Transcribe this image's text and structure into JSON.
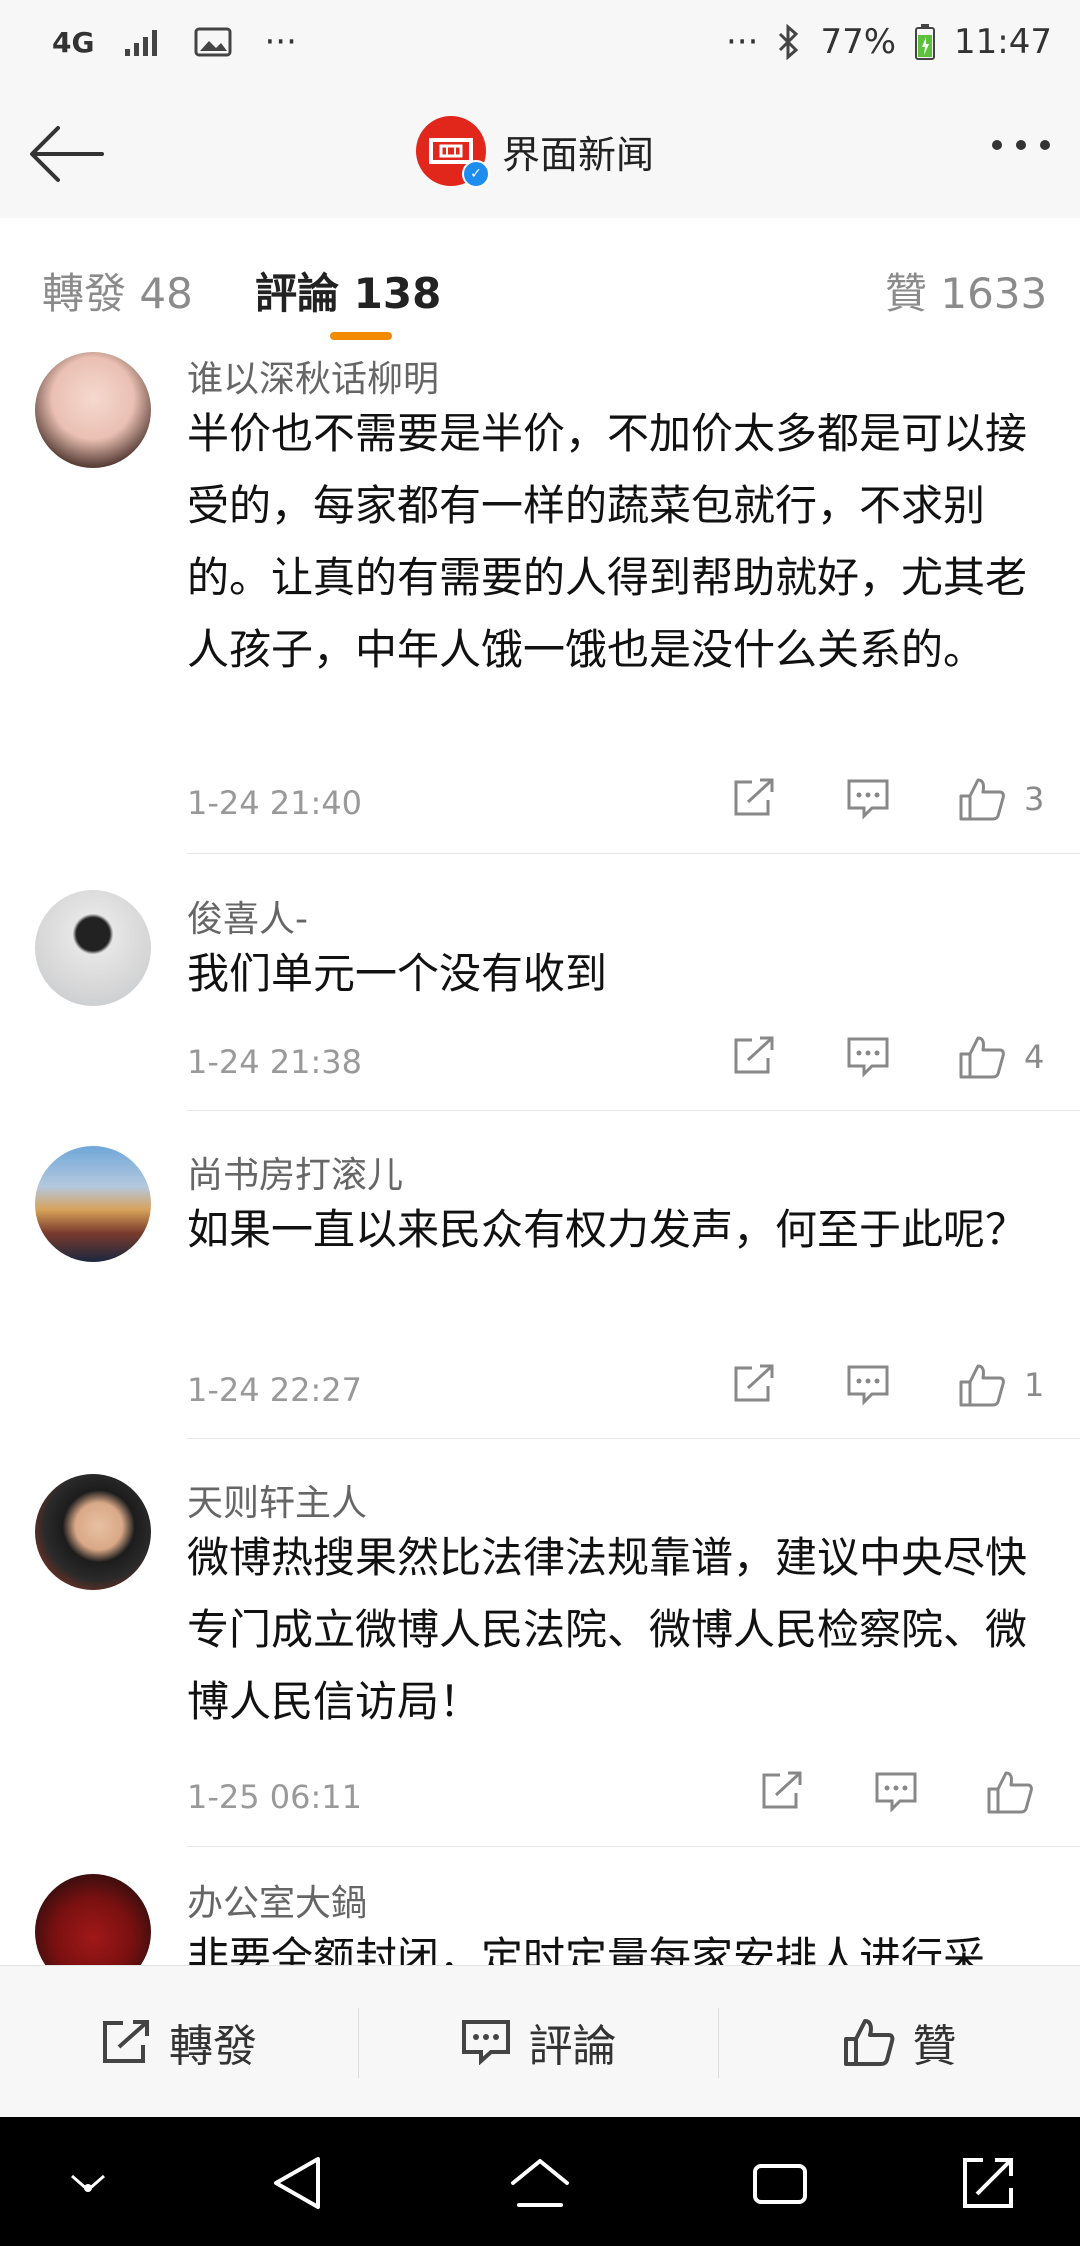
{
  "status_bar": {
    "network": "4G",
    "battery": "77%",
    "time": "11:47",
    "ellipsis": "···"
  },
  "header": {
    "title": "界面新闻",
    "brand_color": "#e1261c"
  },
  "tabs": {
    "repost": "轉發 48",
    "comments": "評論 138",
    "likes": "贊 1633",
    "accent": "#f28a00"
  },
  "comments": [
    {
      "user": "谁以深秋话柳明",
      "text": "半价也不需要是半价，不加价太多都是可以接受的，每家都有一样的蔬菜包就行，不求别的。让真的有需要的人得到帮助就好，尤其老人孩子，中年人饿一饿也是没什么关系的。",
      "time": "1-24 21:40",
      "likes": "3"
    },
    {
      "user": "俊喜人-",
      "text": "我们单元一个没有收到",
      "time": "1-24 21:38",
      "likes": "4"
    },
    {
      "user": "尚书房打滚儿",
      "text": "如果一直以来民众有权力发声，何至于此呢？",
      "time": "1-24 22:27",
      "likes": "1"
    },
    {
      "user": "天则轩主人",
      "text": "微博热搜果然比法律法规靠谱，建议中央尽快专门成立微博人民法院、微博人民检察院、微博人民信访局！",
      "time": "1-25 06:11",
      "likes": ""
    },
    {
      "user": "办公室大鍋",
      "text": "非要全额封闭，定时定量每家安排人进行采",
      "time": "",
      "likes": ""
    }
  ],
  "bottom_bar": {
    "repost": "轉發",
    "comment": "評論",
    "like": "贊"
  }
}
